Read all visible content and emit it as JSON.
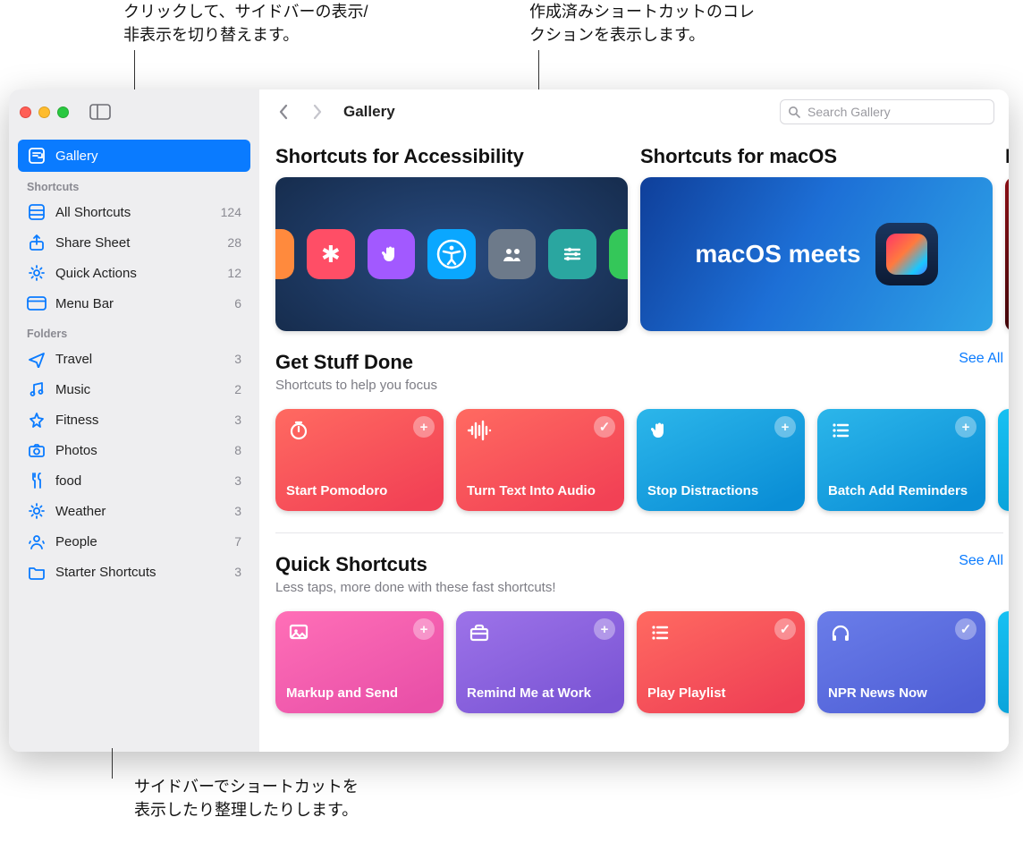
{
  "callouts": {
    "top_left": "クリックして、サイドバーの表示/\n非表示を切り替えます。",
    "top_right": "作成済みショートカットのコレ\nクションを表示します。",
    "bottom": "サイドバーでショートカットを\n表示したり整理したりします。"
  },
  "toolbar": {
    "breadcrumb": "Gallery"
  },
  "search": {
    "placeholder": "Search Gallery"
  },
  "sidebar": {
    "gallery_label": "Gallery",
    "shortcuts_label": "Shortcuts",
    "folders_label": "Folders",
    "shortcuts": [
      {
        "icon": "grid",
        "label": "All Shortcuts",
        "count": 124
      },
      {
        "icon": "share",
        "label": "Share Sheet",
        "count": 28
      },
      {
        "icon": "gear",
        "label": "Quick Actions",
        "count": 12
      },
      {
        "icon": "menubar",
        "label": "Menu Bar",
        "count": 6
      }
    ],
    "folders": [
      {
        "icon": "plane",
        "label": "Travel",
        "count": 3
      },
      {
        "icon": "music",
        "label": "Music",
        "count": 2
      },
      {
        "icon": "fitness",
        "label": "Fitness",
        "count": 3
      },
      {
        "icon": "camera",
        "label": "Photos",
        "count": 8
      },
      {
        "icon": "fork",
        "label": "food",
        "count": 3
      },
      {
        "icon": "sun",
        "label": "Weather",
        "count": 3
      },
      {
        "icon": "people",
        "label": "People",
        "count": 7
      },
      {
        "icon": "folder",
        "label": "Starter Shortcuts",
        "count": 3
      }
    ]
  },
  "hero_banners": [
    {
      "title": "Shortcuts for Accessibility",
      "type": "a11y"
    },
    {
      "title": "Shortcuts for macOS",
      "type": "macos",
      "text": "macOS meets"
    },
    {
      "title": "F…",
      "type": "peek"
    }
  ],
  "sections": [
    {
      "id": "get_stuff_done",
      "title": "Get Stuff Done",
      "subtitle": "Shortcuts to help you focus",
      "see_all": "See All",
      "cards": [
        {
          "icon": "timer",
          "label": "Start Pomodoro",
          "grad": "g-red",
          "corner": "plus"
        },
        {
          "icon": "waveform",
          "label": "Turn Text Into Audio",
          "grad": "g-red",
          "corner": "check"
        },
        {
          "icon": "hand",
          "label": "Stop Distractions",
          "grad": "g-blue",
          "corner": "plus"
        },
        {
          "icon": "list",
          "label": "Batch Add Reminders",
          "grad": "g-blue",
          "corner": "plus"
        }
      ]
    },
    {
      "id": "quick_shortcuts",
      "title": "Quick Shortcuts",
      "subtitle": "Less taps, more done with these fast shortcuts!",
      "see_all": "See All",
      "cards": [
        {
          "icon": "image",
          "label": "Markup and Send",
          "grad": "g-pink",
          "corner": "plus"
        },
        {
          "icon": "briefcase",
          "label": "Remind Me at Work",
          "grad": "g-purple",
          "corner": "plus"
        },
        {
          "icon": "list",
          "label": "Play Playlist",
          "grad": "g-red2",
          "corner": "check"
        },
        {
          "icon": "headphones",
          "label": "NPR News Now",
          "grad": "g-indigo",
          "corner": "check"
        }
      ]
    }
  ]
}
